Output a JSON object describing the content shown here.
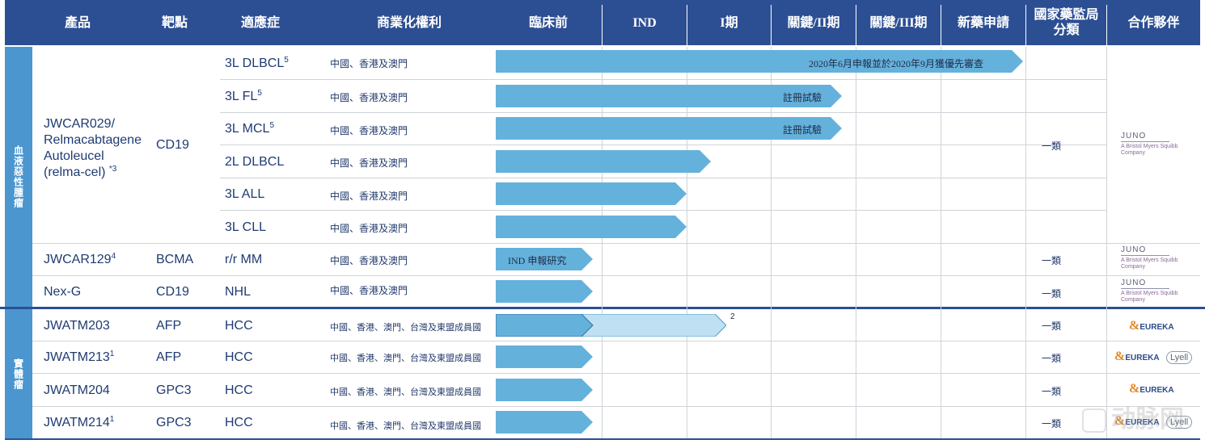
{
  "header": {
    "product": "產品",
    "target": "靶點",
    "indication": "適應症",
    "rights": "商業化權利",
    "preclinical": "臨床前",
    "ind": "IND",
    "phase1": "I期",
    "phase2": "關鍵/II期",
    "phase3": "關鍵/III期",
    "nda": "新藥申請",
    "nmpa_line1": "國家藥監局",
    "nmpa_line2": "分類",
    "partner": "合作夥伴"
  },
  "groups": {
    "heme": "血液惡性腫瘤",
    "solid": "實體瘤"
  },
  "relma": {
    "name_line1": "JWCAR029/",
    "name_line2": "Relmacabtagene",
    "name_line3": "Autoleucel",
    "name_line4": "(relma-cel)",
    "name_sup": "*3",
    "target": "CD19",
    "classification": "一類",
    "partner_logo": "JUNO",
    "partner_sub1": "A Bristol Myers Squibb",
    "partner_sub2": "Company"
  },
  "relma_rows": [
    {
      "indication": "3L DLBCL",
      "sup": "5",
      "rights": "中國、香港及澳門",
      "stage": "新藥申請",
      "note": "2020年6月申報並於2020年9月獲優先審查"
    },
    {
      "indication": "3L FL",
      "sup": "5",
      "rights": "中國、香港及澳門",
      "stage": "關鍵/II期",
      "note": "註冊試驗"
    },
    {
      "indication": "3L MCL",
      "sup": "5",
      "rights": "中國、香港及澳門",
      "stage": "關鍵/II期",
      "note": "註冊試驗"
    },
    {
      "indication": "2L DLBCL",
      "sup": "",
      "rights": "中國、香港及澳門",
      "stage": "I期",
      "note": ""
    },
    {
      "indication": "3L ALL",
      "sup": "",
      "rights": "中國、香港及澳門",
      "stage": "I期",
      "note": ""
    },
    {
      "indication": "3L CLL",
      "sup": "",
      "rights": "中國、香港及澳門",
      "stage": "I期",
      "note": ""
    }
  ],
  "other_rows": [
    {
      "product": "JWCAR129",
      "sup": "4",
      "target": "BCMA",
      "indication": "r/r MM",
      "rights": "中國、香港及澳門",
      "note": "IND 申報研究",
      "classification": "一類",
      "partner": "JUNO"
    },
    {
      "product": "Nex-G",
      "sup": "",
      "target": "CD19",
      "indication": "NHL",
      "rights": "中國、香港及澳門",
      "note": "",
      "classification": "一類",
      "partner": "JUNO"
    },
    {
      "product": "JWATM203",
      "sup": "",
      "target": "AFP",
      "indication": "HCC",
      "rights": "中國、香港、澳門、台灣及東盟成員國",
      "note": "2",
      "classification": "一類",
      "partner": "EUREKA"
    },
    {
      "product": "JWATM213",
      "sup": "1",
      "target": "AFP",
      "indication": "HCC",
      "rights": "中國、香港、澳門、台灣及東盟成員國",
      "note": "",
      "classification": "一類",
      "partner": "EUREKA",
      "partner2": "Lyell"
    },
    {
      "product": "JWATM204",
      "sup": "",
      "target": "GPC3",
      "indication": "HCC",
      "rights": "中國、香港、澳門、台灣及東盟成員國",
      "note": "",
      "classification": "一類",
      "partner": "EUREKA"
    },
    {
      "product": "JWATM214",
      "sup": "1",
      "target": "GPC3",
      "indication": "HCC",
      "rights": "中國、香港、澳門、台灣及東盟成員國",
      "note": "",
      "classification": "一類",
      "partner": "EUREKA",
      "partner2": "Lyell"
    }
  ],
  "watermark": "动脉网",
  "colors": {
    "header": "#2c4f93",
    "arrow": "#64b1dc",
    "arrow_light": "#bfe0f2",
    "side": "#4b96cf"
  }
}
